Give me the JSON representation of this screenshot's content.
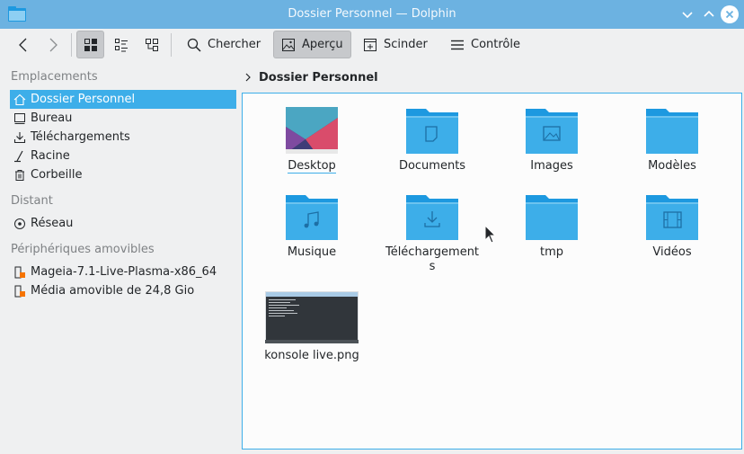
{
  "window": {
    "title": "Dossier Personnel — Dolphin"
  },
  "toolbar": {
    "search_label": "Chercher",
    "preview_label": "Aperçu",
    "split_label": "Scinder",
    "control_label": "Contrôle"
  },
  "sidebar": {
    "sections": {
      "places": "Emplacements",
      "remote": "Distant",
      "removable": "Périphériques amovibles"
    },
    "places": [
      {
        "label": "Dossier Personnel",
        "icon": "home-icon"
      },
      {
        "label": "Bureau",
        "icon": "desktop-icon"
      },
      {
        "label": "Téléchargements",
        "icon": "download-icon"
      },
      {
        "label": "Racine",
        "icon": "root-icon"
      },
      {
        "label": "Corbeille",
        "icon": "trash-icon"
      }
    ],
    "remote": [
      {
        "label": "Réseau",
        "icon": "network-icon"
      }
    ],
    "removable": [
      {
        "label": "Mageia-7.1-Live-Plasma-x86_64",
        "icon": "usb-drive-icon"
      },
      {
        "label": "Média amovible de 24,8 Gio",
        "icon": "usb-drive-icon"
      }
    ]
  },
  "breadcrumb": {
    "current": "Dossier Personnel"
  },
  "files": [
    {
      "name": "Desktop",
      "icon": "desktop-wallpaper-thumbnail"
    },
    {
      "name": "Documents",
      "icon": "folder-documents-icon"
    },
    {
      "name": "Images",
      "icon": "folder-images-icon"
    },
    {
      "name": "Modèles",
      "icon": "folder-icon"
    },
    {
      "name": "Musique",
      "icon": "folder-music-icon"
    },
    {
      "name": "Téléchargement\ns",
      "icon": "folder-download-icon"
    },
    {
      "name": "tmp",
      "icon": "folder-icon"
    },
    {
      "name": "Vidéos",
      "icon": "folder-videos-icon"
    },
    {
      "name": "konsole live.png",
      "icon": "konsole-screenshot-thumbnail"
    }
  ],
  "colors": {
    "accent": "#3daee9",
    "titlebar": "#6cb2e1",
    "folder_body": "#3daee9",
    "folder_tab": "#1d99e0"
  }
}
